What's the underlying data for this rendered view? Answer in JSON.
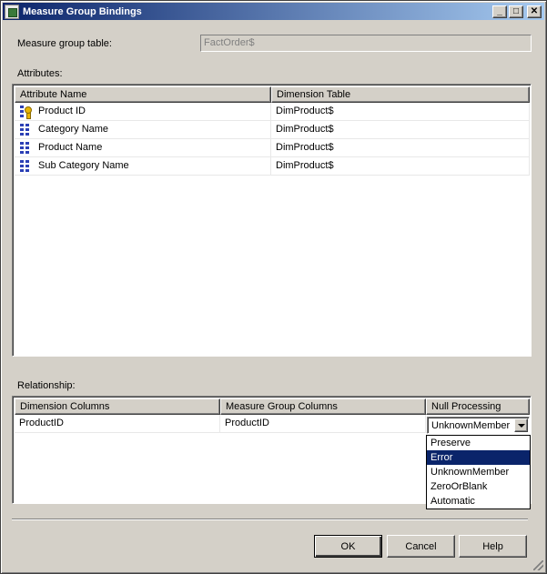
{
  "window": {
    "title": "Measure Group Bindings",
    "minimize": "_",
    "maximize": "□",
    "close": "✕"
  },
  "measure_group": {
    "label": "Measure group table:",
    "value": "FactOrder$"
  },
  "attributes": {
    "label": "Attributes:",
    "columns": [
      "Attribute Name",
      "Dimension Table"
    ],
    "rows": [
      {
        "name": "Product ID",
        "table": "DimProduct$",
        "icon": "key-attribute-icon"
      },
      {
        "name": "Category Name",
        "table": "DimProduct$",
        "icon": "attribute-icon"
      },
      {
        "name": "Product Name",
        "table": "DimProduct$",
        "icon": "attribute-icon"
      },
      {
        "name": "Sub Category Name",
        "table": "DimProduct$",
        "icon": "attribute-icon"
      }
    ]
  },
  "relationship": {
    "label": "Relationship:",
    "columns": [
      "Dimension Columns",
      "Measure Group Columns",
      "Null Processing"
    ],
    "row": {
      "dimension": "ProductID",
      "measure_group": "ProductID",
      "null_processing": "UnknownMember"
    },
    "options": [
      "Preserve",
      "Error",
      "UnknownMember",
      "ZeroOrBlank",
      "Automatic"
    ],
    "highlighted_option": "Error"
  },
  "buttons": {
    "ok": "OK",
    "cancel": "Cancel",
    "help": "Help"
  },
  "colors": {
    "selection": "#0a246a",
    "title_start": "#0a246a",
    "title_end": "#a6caf0"
  }
}
